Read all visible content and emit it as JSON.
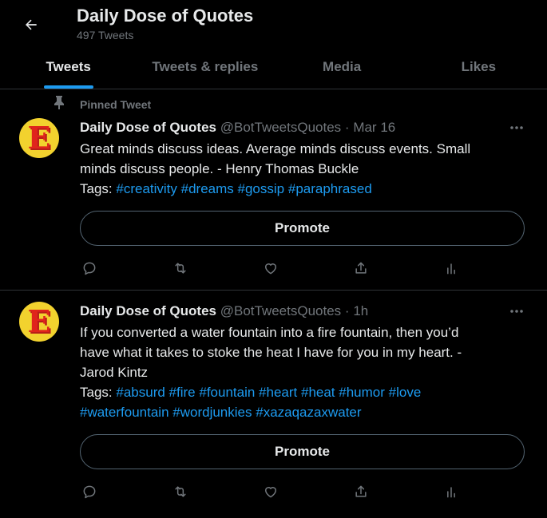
{
  "header": {
    "back_icon": "arrow-left-icon",
    "title": "Daily Dose of Quotes",
    "subtitle": "497 Tweets"
  },
  "tabs": [
    {
      "label": "Tweets",
      "active": true
    },
    {
      "label": "Tweets & replies",
      "active": false
    },
    {
      "label": "Media",
      "active": false
    },
    {
      "label": "Likes",
      "active": false
    }
  ],
  "colors": {
    "accent": "#1d9bf0",
    "avatar_bg": "#f2d22e",
    "avatar_letter": "#e0241c",
    "muted": "#71767b"
  },
  "tweets": [
    {
      "pinned_label": "Pinned Tweet",
      "avatar_letter": "E",
      "name": "Daily Dose of Quotes",
      "handle": "@BotTweetsQuotes",
      "separator": "·",
      "time": "Mar 16",
      "text_lines": [
        "Great minds discuss ideas. Average minds discuss events. Small",
        "minds discuss people. - Henry Thomas Buckle"
      ],
      "tags_label": "Tags:",
      "tag_lines": [
        [
          "#creativity",
          "#dreams",
          "#gossip",
          "#paraphrased"
        ]
      ],
      "promote_label": "Promote",
      "action_icons": [
        "reply-icon",
        "retweet-icon",
        "like-icon",
        "share-icon",
        "analytics-icon"
      ]
    },
    {
      "avatar_letter": "E",
      "name": "Daily Dose of Quotes",
      "handle": "@BotTweetsQuotes",
      "separator": "·",
      "time": "1h",
      "text_lines": [
        "If you converted a water fountain into a fire fountain, then you’d",
        "have what it takes to stoke the heat I have for you in my heart. -",
        "Jarod Kintz"
      ],
      "tags_label": "Tags:",
      "tag_lines": [
        [
          "#absurd",
          "#fire",
          "#fountain",
          "#heart",
          "#heat",
          "#humor",
          "#love"
        ],
        [
          "#waterfountain",
          "#wordjunkies",
          "#xazaqazaxwater"
        ]
      ],
      "promote_label": "Promote",
      "action_icons": [
        "reply-icon",
        "retweet-icon",
        "like-icon",
        "share-icon",
        "analytics-icon"
      ]
    }
  ]
}
